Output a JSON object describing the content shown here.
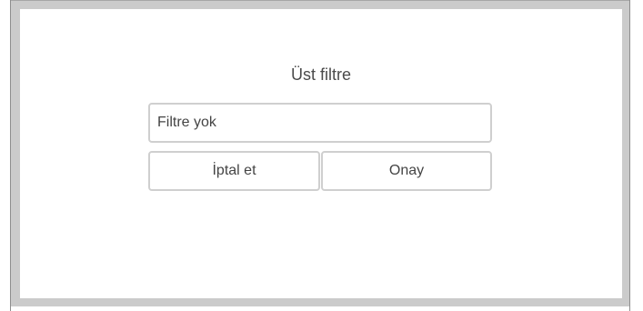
{
  "dialog": {
    "title": "Üst filtre",
    "filter_input": {
      "value": "",
      "placeholder": "Filtre yok"
    },
    "cancel_label": "İptal et",
    "confirm_label": "Onay"
  }
}
